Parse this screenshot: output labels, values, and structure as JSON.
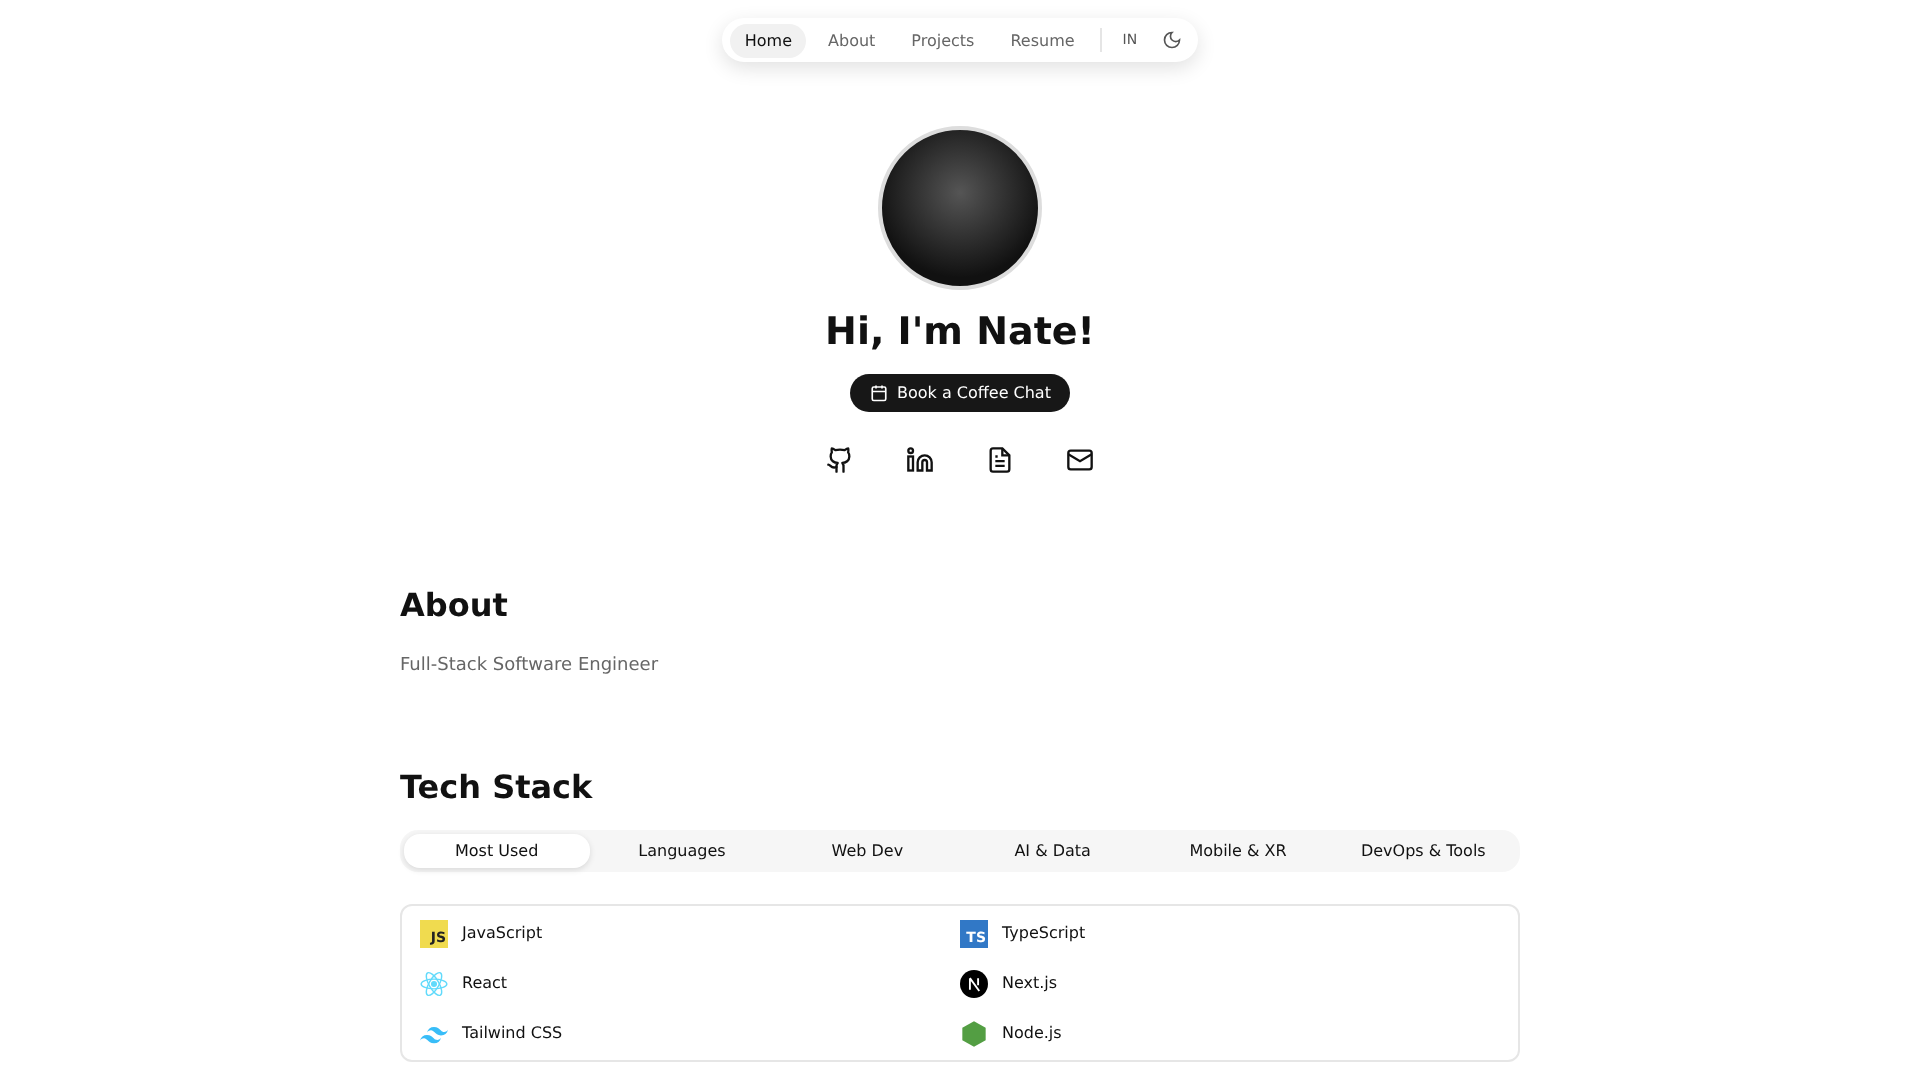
{
  "nav": {
    "links": [
      {
        "label": "Home",
        "selected": true
      },
      {
        "label": "About",
        "selected": false
      },
      {
        "label": "Projects",
        "selected": false
      },
      {
        "label": "Resume",
        "selected": false
      }
    ],
    "language_short": "IN"
  },
  "hero": {
    "title": "Hi, I'm Nate!",
    "cta": "Book a Coffee Chat",
    "socials": [
      {
        "kind": "github"
      },
      {
        "kind": "linkedin"
      },
      {
        "kind": "document"
      },
      {
        "kind": "mail"
      }
    ]
  },
  "about": {
    "heading": "About",
    "subtitle": "Full-Stack Software Engineer"
  },
  "tech_stack": {
    "heading": "Tech Stack",
    "tabs": [
      {
        "label": "Most Used",
        "selected": true
      },
      {
        "label": "Languages",
        "selected": false
      },
      {
        "label": "Web Dev",
        "selected": false
      },
      {
        "label": "AI & Data",
        "selected": false
      },
      {
        "label": "Mobile & XR",
        "selected": false
      },
      {
        "label": "DevOps & Tools",
        "selected": false
      }
    ],
    "items": [
      {
        "name": "JavaScript",
        "kind": "js",
        "logo_text": "JS"
      },
      {
        "name": "TypeScript",
        "kind": "ts",
        "logo_text": "TS"
      },
      {
        "name": "React",
        "kind": "react"
      },
      {
        "name": "Next.js",
        "kind": "next"
      },
      {
        "name": "Tailwind CSS",
        "kind": "tailwind"
      },
      {
        "name": "Node.js",
        "kind": "node"
      }
    ]
  }
}
